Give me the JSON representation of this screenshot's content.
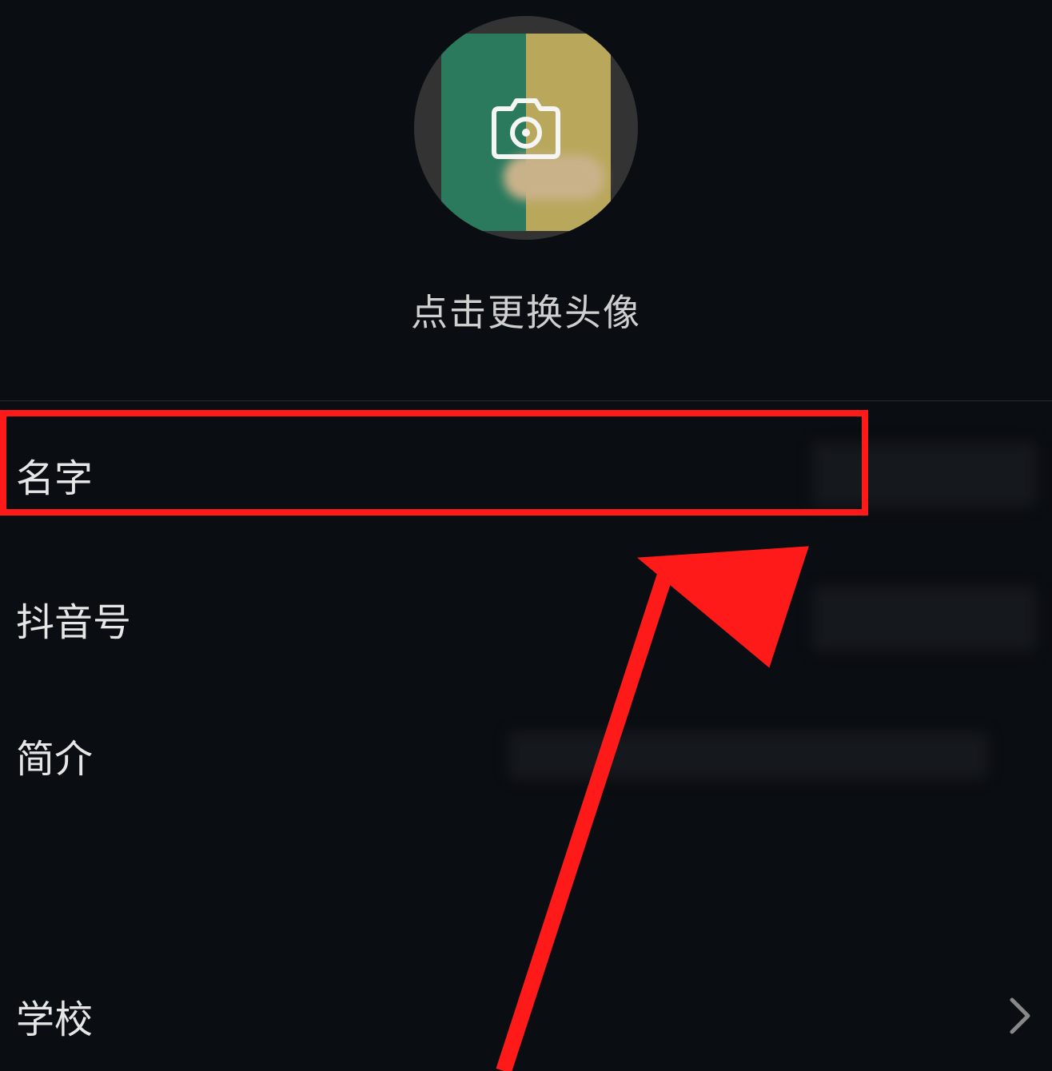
{
  "profile": {
    "change_avatar_hint": "点击更换头像",
    "camera_icon": "camera-icon"
  },
  "form": {
    "rows": [
      {
        "key": "name",
        "label": "名字",
        "has_chevron": false
      },
      {
        "key": "douyin",
        "label": "抖音号",
        "has_chevron": false
      },
      {
        "key": "intro",
        "label": "简介",
        "has_chevron": false
      },
      {
        "key": "school",
        "label": "学校",
        "has_chevron": true
      }
    ]
  },
  "annotation": {
    "highlight_color": "#ff1a1a",
    "arrow_color": "#ff1a1a"
  }
}
